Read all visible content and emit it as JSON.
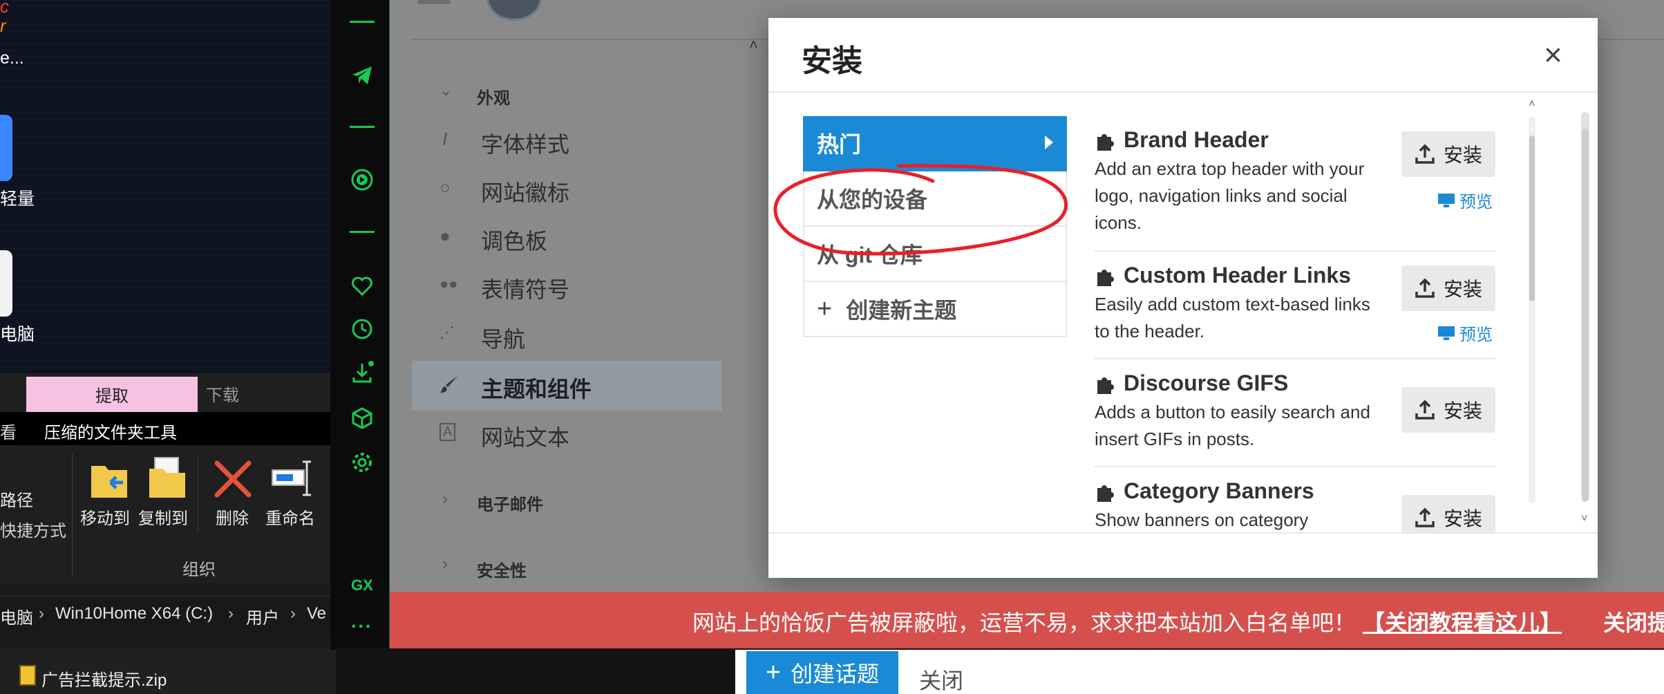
{
  "desktop": {
    "icon_label_1": "e...",
    "icon_label_2": "轻量",
    "icon_label_3": "电脑"
  },
  "explorer": {
    "tab_extract": "提取",
    "tab_download": "下载",
    "tab_view_partial": "看",
    "tab_compressed_tools": "压缩的文件夹工具",
    "path_label": "路径",
    "shortcut_label": "快捷方式",
    "move_to": "移动到",
    "copy_to": "复制到",
    "delete": "删除",
    "rename": "重命名",
    "group_label": "组织",
    "breadcrumb": [
      "电脑",
      "Win10Home X64 (C:)",
      "用户",
      "Ve"
    ],
    "zip_file": "广告拦截提示.zip"
  },
  "gx_sidebar": {
    "label": "GX",
    "more": "···"
  },
  "admin_nav": {
    "section_appearance": "外观",
    "items": [
      {
        "label": "字体样式",
        "icon": "italic-icon"
      },
      {
        "label": "网站徽标",
        "icon": "chat-bubble-icon"
      },
      {
        "label": "调色板",
        "icon": "palette-icon"
      },
      {
        "label": "表情符号",
        "icon": "emoji-icon"
      },
      {
        "label": "导航",
        "icon": "share-nodes-icon"
      },
      {
        "label": "主题和组件",
        "icon": "brush-icon",
        "active": true
      },
      {
        "label": "网站文本",
        "icon": "text-icon"
      }
    ],
    "section_email": "电子邮件",
    "section_security": "安全性"
  },
  "modal": {
    "title": "安装",
    "close_glyph": "×",
    "side_tabs": [
      {
        "label": "热门",
        "active": true
      },
      {
        "label": "从您的设备"
      },
      {
        "label": "从 git 仓库"
      },
      {
        "label": "创建新主题",
        "icon": "+"
      }
    ],
    "themes": [
      {
        "name": "Brand Header",
        "description": "Add an extra top header with your logo, navigation links and social icons.",
        "install": "安装",
        "preview": "预览"
      },
      {
        "name": "Custom Header Links",
        "description": "Easily add custom text-based links to the header.",
        "install": "安装",
        "preview": "预览"
      },
      {
        "name": "Discourse GIFS",
        "description": "Adds a button to easily search and insert GIFs in posts.",
        "install": "安装"
      },
      {
        "name": "Category Banners",
        "description": "Show banners on category",
        "install": "安装"
      }
    ]
  },
  "banner": {
    "text": "网站上的恰饭广告被屏蔽啦，运营不易，求求把本站加入白名单吧！",
    "link": "【关闭教程看这儿】",
    "close": "关闭提"
  },
  "composer": {
    "create_topic": "创建话题",
    "create_plus": "+",
    "close": "关闭"
  },
  "colors": {
    "accent_blue": "#1a8ad6",
    "gx_green": "#19c855",
    "banner_red": "#d5504d",
    "annotation_red": "#e8202a"
  }
}
